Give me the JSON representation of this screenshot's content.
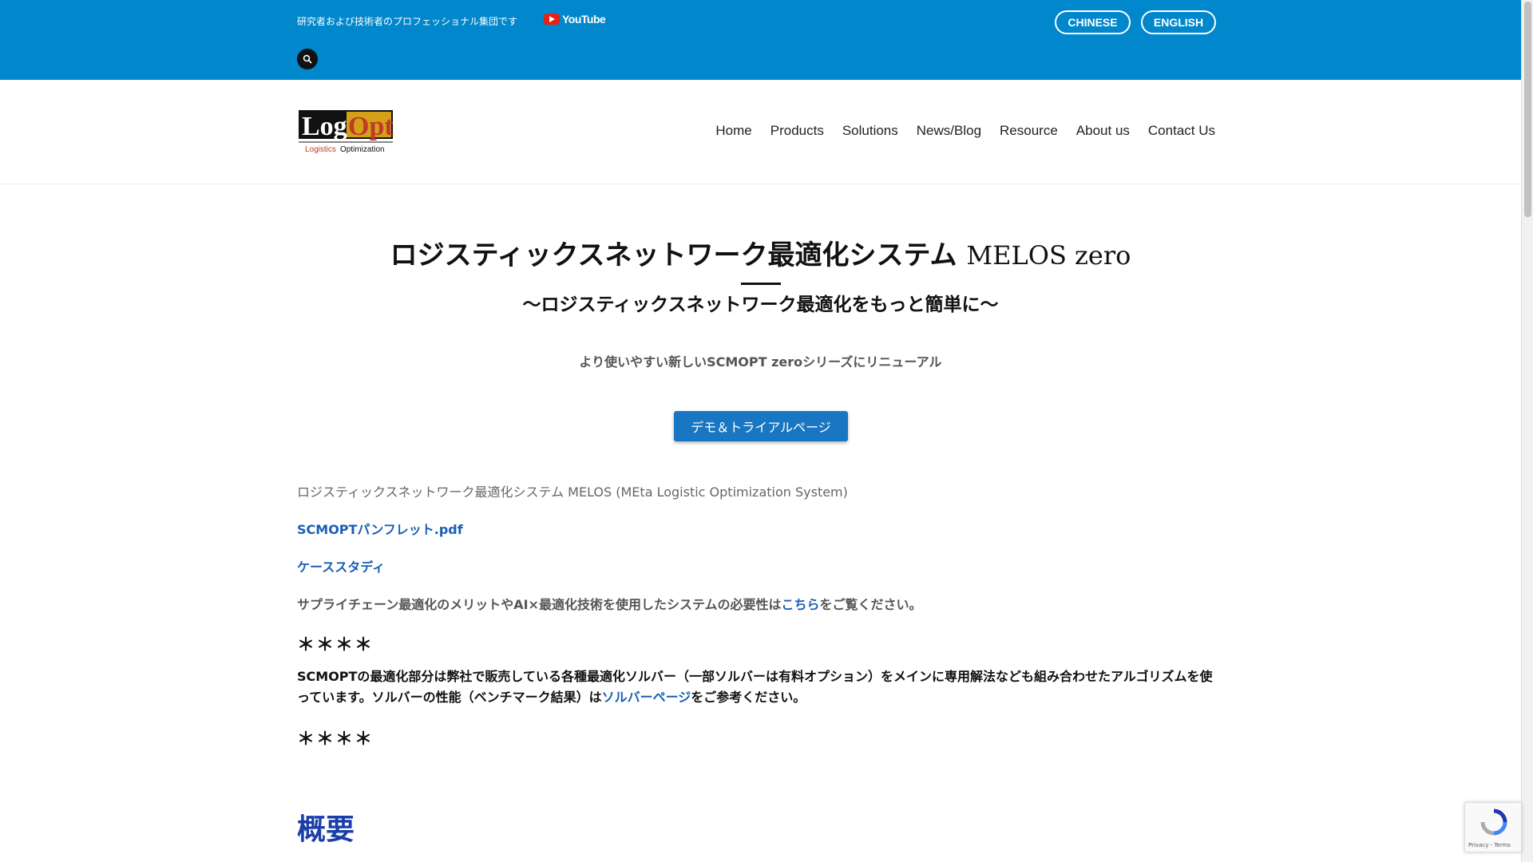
{
  "topbar": {
    "tagline": "研究者および技術者のプロフェッショナル集団です",
    "youtube_label": "YouTube",
    "lang_chinese": "CHINESE",
    "lang_english": "ENGLISH"
  },
  "logo": {
    "main": "LogOpt",
    "sub_left": "Logistics",
    "sub_right": "Optimization"
  },
  "nav": [
    "Home",
    "Products",
    "Solutions",
    "News/Blog",
    "Resource",
    "About us",
    "Contact Us"
  ],
  "main": {
    "title_jp": "ロジスティックスネットワーク最適化システム",
    "title_en": "MELOS zero",
    "subtitle": "〜ロジスティックスネットワーク最適化をもっと簡単に〜",
    "note": "より使いやすい新しいSCMOPT zeroシリーズにリニューアル",
    "demo_button": "デモ＆トライアルページ",
    "description": "ロジスティックスネットワーク最適化システム MELOS (MEta Logistic Optimization System)",
    "link_pamphlet": "SCMOPTパンフレット.pdf",
    "link_case": "ケーススタディ",
    "merit_prefix": "サプライチェーン最適化のメリットやAI×最適化技術を使用したシステムの必要性は",
    "merit_link": "こちら",
    "merit_suffix": "をご覧ください。",
    "stars": "＊＊＊＊",
    "body_prefix": "SCMOPTの最適化部分は弊社で販売している各種最適化ソルバー（一部ソルバーは有料オプション）をメインに専用解法なども組み合わせたアルゴリズムを使っています。ソルバーの性能（ベンチマーク結果）は",
    "body_link": "ソルバーページ",
    "body_suffix": "をご参考ください。",
    "section_heading": "概要"
  },
  "recaptcha": {
    "label": "Privacy - Terms"
  },
  "colors": {
    "topbar": "#0087cc",
    "button": "#1976c2",
    "link": "#1a5fb4",
    "section_heading": "#1a3ea8"
  }
}
